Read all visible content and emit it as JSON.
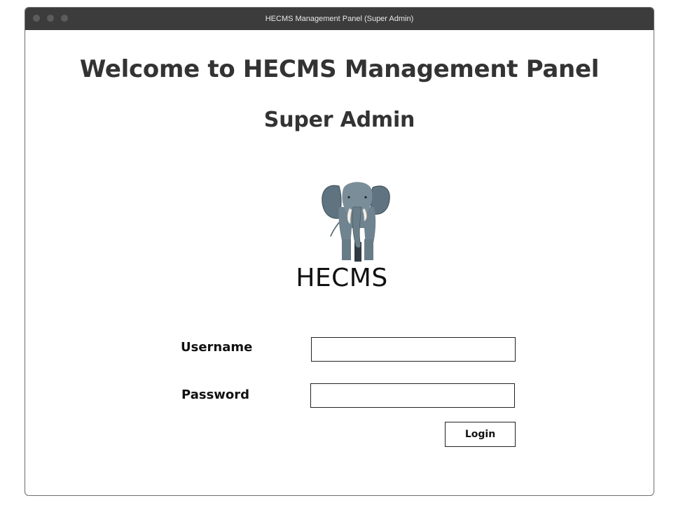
{
  "window": {
    "title": "HECMS Management Panel (Super Admin)"
  },
  "header": {
    "welcome": "Welcome to HECMS Management Panel",
    "role": "Super Admin"
  },
  "logo": {
    "icon": "elephant-icon",
    "text": "HECMS"
  },
  "form": {
    "username_label": "Username",
    "username_value": "",
    "password_label": "Password",
    "password_value": "",
    "login_label": "Login"
  }
}
